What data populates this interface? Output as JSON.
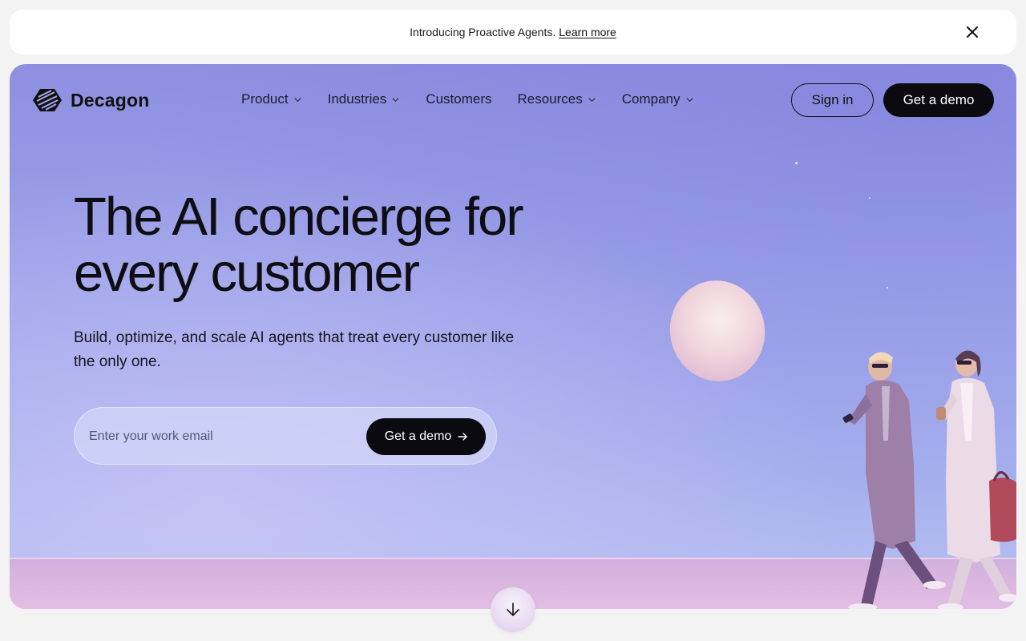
{
  "announcement": {
    "text": "Introducing Proactive Agents.",
    "link": "Learn more"
  },
  "brand": {
    "name": "Decagon"
  },
  "nav": {
    "items": [
      {
        "label": "Product",
        "has_dropdown": true
      },
      {
        "label": "Industries",
        "has_dropdown": true
      },
      {
        "label": "Customers",
        "has_dropdown": false
      },
      {
        "label": "Resources",
        "has_dropdown": true
      },
      {
        "label": "Company",
        "has_dropdown": true
      }
    ],
    "sign_in": "Sign in",
    "get_demo": "Get a demo"
  },
  "hero": {
    "headline_line1": "The AI concierge for",
    "headline_line2": "every customer",
    "subtext": "Build, optimize, and scale AI agents that treat every customer like the only one.",
    "email_placeholder": "Enter your work email",
    "cta": "Get a demo"
  },
  "icons": {
    "close": "close-icon",
    "chevron": "chevron-down-icon",
    "arrow": "arrow-right-icon",
    "scroll": "arrow-down-icon"
  },
  "colors": {
    "sky": "#9ea5ea",
    "primary_button": "#0b0b0f",
    "page_bg": "#f3f3f3"
  }
}
